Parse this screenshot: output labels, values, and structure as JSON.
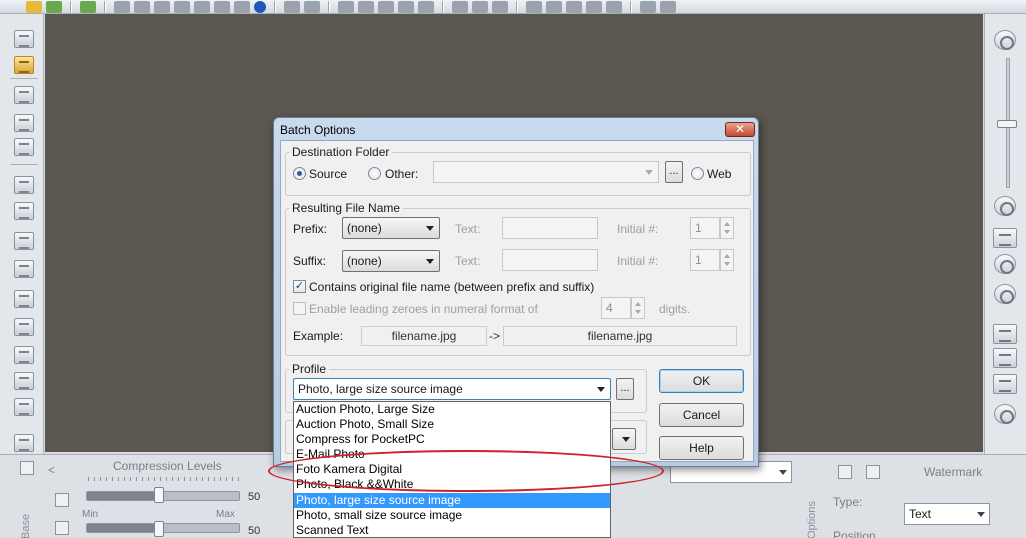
{
  "dialog": {
    "title": "Batch Options",
    "close_symbol": "✕",
    "destination": {
      "group_label": "Destination Folder",
      "source_label": "Source",
      "other_label": "Other:",
      "other_path": "",
      "browse_label": "...",
      "web_label": "Web",
      "selected": "Source"
    },
    "filename": {
      "group_label": "Resulting File Name",
      "prefix_label": "Prefix:",
      "prefix_value": "(none)",
      "suffix_label": "Suffix:",
      "suffix_value": "(none)",
      "text_label": "Text:",
      "initial_label": "Initial #:",
      "prefix_initial": "1",
      "suffix_initial": "1",
      "contains_original_label": "Contains original file name (between prefix and suffix)",
      "contains_original_checked": true,
      "leading_zeroes_label": "Enable leading zeroes in numeral format of",
      "leading_zeroes_checked": false,
      "digits_value": "4",
      "digits_label": "digits.",
      "example_label": "Example:",
      "example_source": "filename.jpg",
      "example_arrow": "->",
      "example_result": "filename.jpg"
    },
    "profile": {
      "group_label": "Profile",
      "selected": "Photo, large size source image",
      "more_label": "...",
      "options": [
        "Auction Photo, Large Size",
        "Auction Photo, Small Size",
        "Compress for PocketPC",
        "E-Mail Photo",
        "Foto Kamera Digital",
        "Photo, Black &&White",
        "Photo, large size source image",
        "Photo, small size source image",
        "Scanned Text"
      ],
      "highlighted_index": 6
    },
    "buttons": {
      "ok": "OK",
      "cancel": "Cancel",
      "help": "Help"
    }
  },
  "bottom_panel": {
    "compression_levels_label": "Compression Levels",
    "slider1_value": "50",
    "slider2_value": "50",
    "min_label": "Min",
    "max_label": "Max",
    "base_label": "Base",
    "options_label": "Options",
    "watermark_label": "Watermark",
    "type_label": "Type:",
    "type_value": "Text",
    "position_label": "Position",
    "scroll_left": "<"
  },
  "colors": {
    "canvas": "#5c5650",
    "selection": "#3399ff",
    "annotation_ring": "#d0202a",
    "close_button": "#c24a2e"
  }
}
